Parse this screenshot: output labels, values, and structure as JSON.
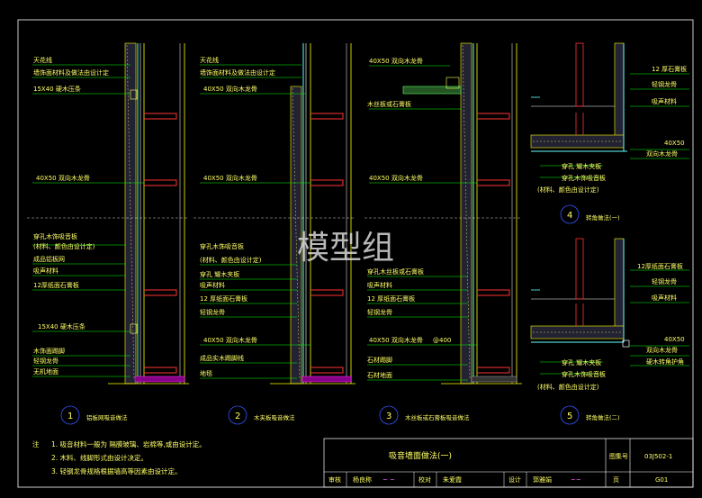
{
  "watermark": "模型组",
  "details": [
    {
      "number": "1",
      "caption": "铝板网吸音做法",
      "top_labels": [
        "天花线",
        "墙饰面材料及做法由设计定",
        "15X40 硬木压条",
        "40X50 双向木龙骨"
      ],
      "bottom_labels": [
        "穿孔木饰吸音板",
        "(材料、颜色由设计定)",
        "成品铝板网",
        "吸声材料",
        "12厚纸面石膏板",
        "15X40 硬木压条",
        "木饰面踢脚",
        "轻钢龙骨",
        "无机地面"
      ]
    },
    {
      "number": "2",
      "caption": "木夹板吸音做法",
      "top_labels": [
        "天花线",
        "墙饰面材料及做法由设计定",
        "40X50 双向木龙骨",
        "40X50 双向木龙骨"
      ],
      "bottom_labels": [
        "穿孔木饰吸音板",
        "(材料、颜色由设计定)",
        "穿孔 耀木夹板",
        "吸声材料",
        "12 厚纸面石膏板",
        "轻钢龙骨",
        "40X50 双向木龙骨",
        "成品实木踢脚线",
        "地毯"
      ]
    },
    {
      "number": "3",
      "caption": "木丝板或石膏板吸音做法",
      "top_labels": [
        "40X50 双向木龙骨",
        "木丝板或石膏板",
        "40X50 双向木龙骨"
      ],
      "bottom_labels": [
        "穿孔木丝板或石膏板",
        "吸声材料",
        "12 厚纸面石膏板",
        "轻钢龙骨",
        "40X50 双向木龙骨",
        "@400",
        "石材踢脚",
        "石材地面"
      ]
    },
    {
      "number": "4",
      "caption": "转角做法(一)",
      "right_labels": [
        "12 厚石膏板",
        "轻钢龙骨",
        "吸声材料",
        "40X50",
        "双向木龙骨"
      ],
      "bottom_labels": [
        "穿孔 耀木夹板",
        "穿孔木饰吸音板",
        "(材料、颜色由设计定)"
      ]
    },
    {
      "number": "5",
      "caption": "转角做法(二)",
      "right_labels": [
        "12厚纸面石膏板",
        "轻钢龙骨",
        "吸声材料",
        "40X50",
        "双向木龙骨",
        "硬木转角护角"
      ],
      "bottom_labels": [
        "穿孔 耀木夹板",
        "穿孔木饰吸音板",
        "(材料、颜色由设计定)"
      ]
    }
  ],
  "notes": {
    "prefix": "注",
    "lines": [
      "1. 吸音材料一般为  隔膜玻璃、岩棉等,或由设计定。",
      "2. 木料、线脚形式由设计决定。",
      "3. 轻钢龙骨规格根据墙高等因素由设计定。"
    ]
  },
  "title_block": {
    "title": "吸音墙面做法(一)",
    "atlas_label": "图集号",
    "atlas_no": "03J502-1",
    "review_label": "审核",
    "reviewer": "杨良称",
    "check_label": "校对",
    "checker": "朱爱霞",
    "design_label": "设计",
    "designer": "郭雅娟",
    "page_label": "页",
    "page_no": "G01"
  },
  "colors": {
    "background": "#000000",
    "annotation": "#ffff66",
    "leader": "#00ff00",
    "stud": "#ff3333",
    "wall": "#ffff00",
    "finish": "#66ffff",
    "magenta": "#ff33ff"
  }
}
